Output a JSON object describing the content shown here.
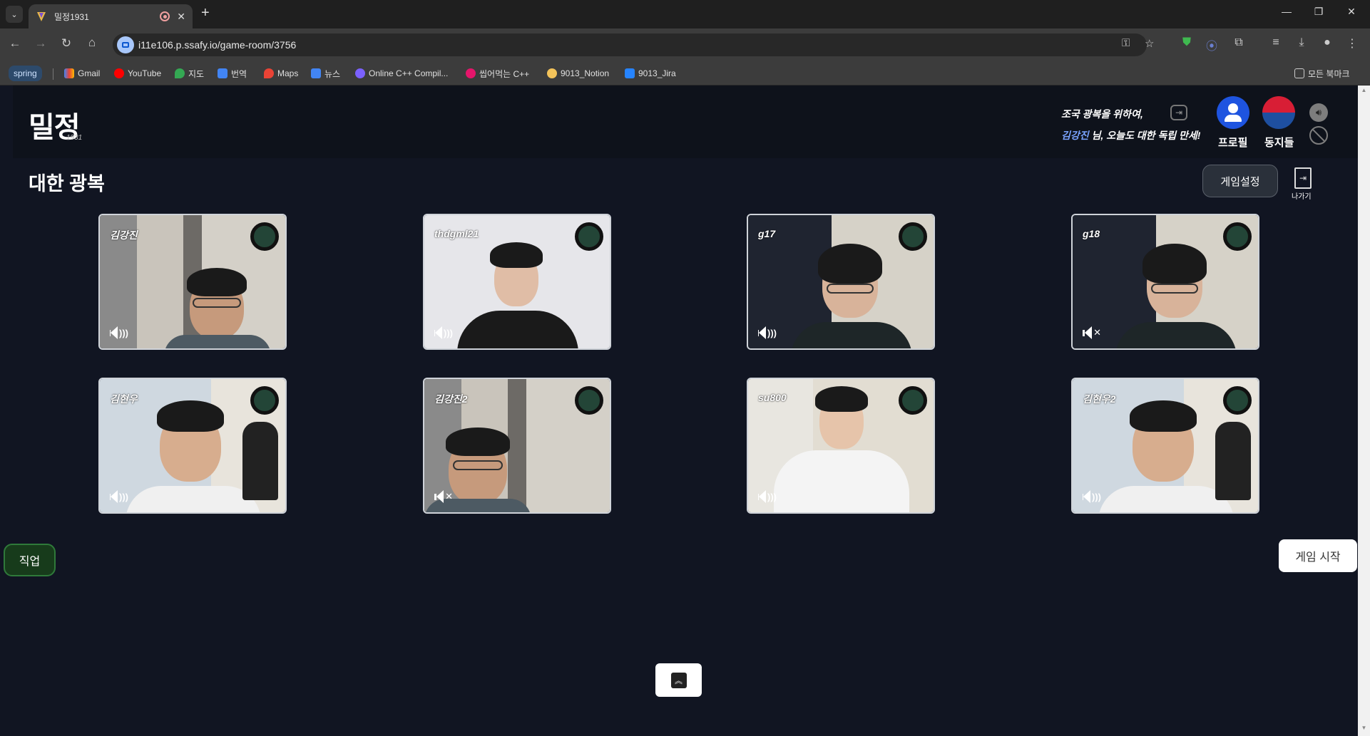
{
  "browser": {
    "tab_title": "밀정1931",
    "url": "i11e106.p.ssafy.io/game-room/3756",
    "bookmarks": [
      "spring",
      "Gmail",
      "YouTube",
      "지도",
      "번역",
      "Maps",
      "뉴스",
      "Online C++ Compil...",
      "씹어먹는 C++",
      "9013_Notion",
      "9013_Jira"
    ],
    "bookmarks_folder": "모든 북마크"
  },
  "header": {
    "logo": "밀정",
    "logo_sub": "1931",
    "message_line1": "조국 광복을 위하여,",
    "message_name": "김강진",
    "message_line2_rest": " 님, 오늘도 대한 독립 만세!",
    "profile_label": "프로필",
    "comrades_label": "동지들"
  },
  "room": {
    "title": "대한 광복",
    "settings_label": "게임설정",
    "exit_label": "나가기"
  },
  "players": [
    {
      "nickname": "김강진",
      "audio": "on"
    },
    {
      "nickname": "thdgml21",
      "audio": "on"
    },
    {
      "nickname": "g17",
      "audio": "on"
    },
    {
      "nickname": "g18",
      "audio": "muted"
    },
    {
      "nickname": "김현우",
      "audio": "on"
    },
    {
      "nickname": "김강진2",
      "audio": "muted"
    },
    {
      "nickname": "su800",
      "audio": "on"
    },
    {
      "nickname": "김현우2",
      "audio": "on"
    }
  ],
  "actions": {
    "job_label": "직업",
    "start_label": "게임 시작"
  },
  "colors": {
    "page_bg": "#111522",
    "ready_indicator": "#234537",
    "job_button": "#173b1b",
    "profile_button": "#1e54e0"
  }
}
